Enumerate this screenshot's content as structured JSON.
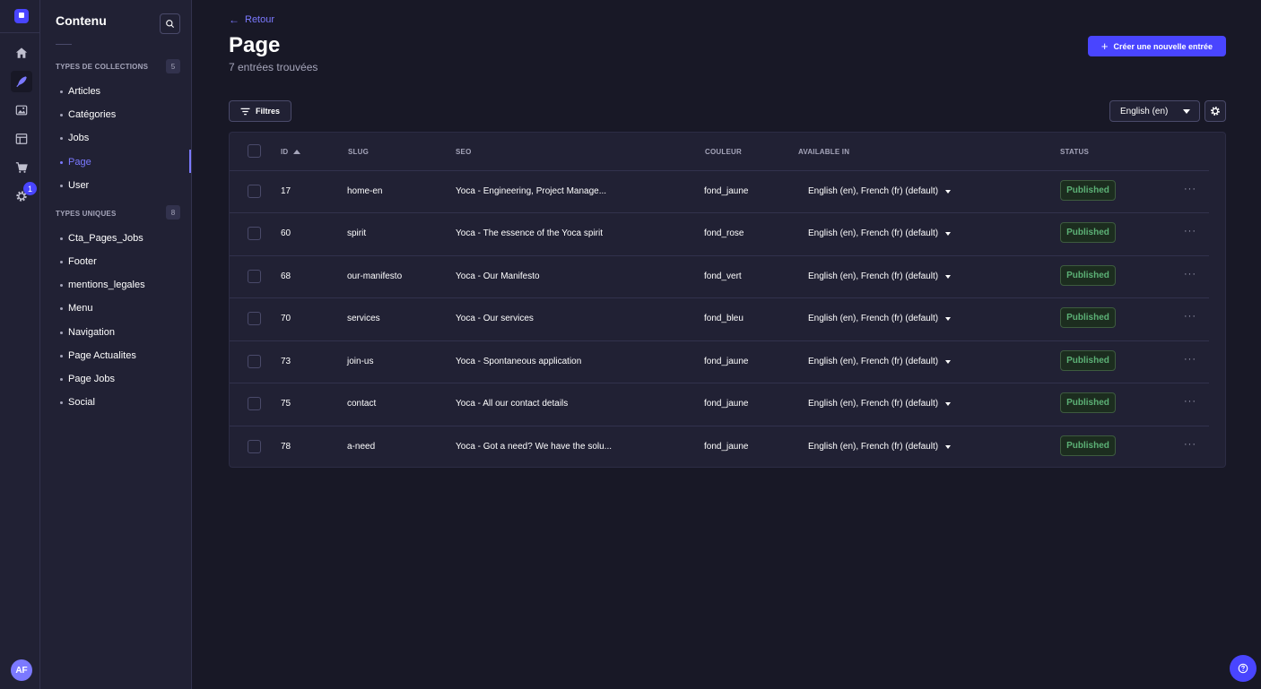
{
  "colors": {
    "accent": "#4945ff",
    "published_bg": "#1c2d1f",
    "published_text": "#5cb176",
    "background": "#181826",
    "panel": "#212134"
  },
  "rail": {
    "icons": [
      "logo-icon",
      "home-icon",
      "content-manager-icon",
      "media-library-icon",
      "content-type-builder-icon",
      "marketplace-icon",
      "settings-icon"
    ],
    "settings_badge": "1",
    "avatar_initials": "AF"
  },
  "sidenav": {
    "title": "Contenu",
    "collections": {
      "label": "TYPES DE COLLECTIONS",
      "count": "5",
      "items": [
        "Articles",
        "Catégories",
        "Jobs",
        "Page",
        "User"
      ]
    },
    "singles": {
      "label": "TYPES UNIQUES",
      "count": "8",
      "items": [
        "Cta_Pages_Jobs",
        "Footer",
        "mentions_legales",
        "Menu",
        "Navigation",
        "Page Actualites",
        "Page Jobs",
        "Social"
      ]
    }
  },
  "header": {
    "back_label": "Retour",
    "title": "Page",
    "subtitle": "7 entrées trouvées",
    "create_label": "Créer une nouvelle entrée"
  },
  "toolbar": {
    "filters_label": "Filtres",
    "locale_value": "English (en)"
  },
  "table": {
    "columns": [
      "ID",
      "SLUG",
      "SEO",
      "COULEUR",
      "AVAILABLE IN",
      "STATUS"
    ],
    "rows": [
      {
        "id": "17",
        "slug": "home-en",
        "seo": "Yoca - Engineering, Project Manage...",
        "color": "fond_jaune",
        "locales": "English (en), French (fr) (default)",
        "status": "Published"
      },
      {
        "id": "60",
        "slug": "spirit",
        "seo": "Yoca - The essence of the Yoca spirit",
        "color": "fond_rose",
        "locales": "English (en), French (fr) (default)",
        "status": "Published"
      },
      {
        "id": "68",
        "slug": "our-manifesto",
        "seo": "Yoca - Our Manifesto",
        "color": "fond_vert",
        "locales": "English (en), French (fr) (default)",
        "status": "Published"
      },
      {
        "id": "70",
        "slug": "services",
        "seo": "Yoca - Our services",
        "color": "fond_bleu",
        "locales": "English (en), French (fr) (default)",
        "status": "Published"
      },
      {
        "id": "73",
        "slug": "join-us",
        "seo": "Yoca - Spontaneous application",
        "color": "fond_jaune",
        "locales": "English (en), French (fr) (default)",
        "status": "Published"
      },
      {
        "id": "75",
        "slug": "contact",
        "seo": "Yoca - All our contact details",
        "color": "fond_jaune",
        "locales": "English (en), French (fr) (default)",
        "status": "Published"
      },
      {
        "id": "78",
        "slug": "a-need",
        "seo": "Yoca - Got a need? We have the solu...",
        "color": "fond_jaune",
        "locales": "English (en), French (fr) (default)",
        "status": "Published"
      }
    ],
    "row_menu": "···"
  }
}
